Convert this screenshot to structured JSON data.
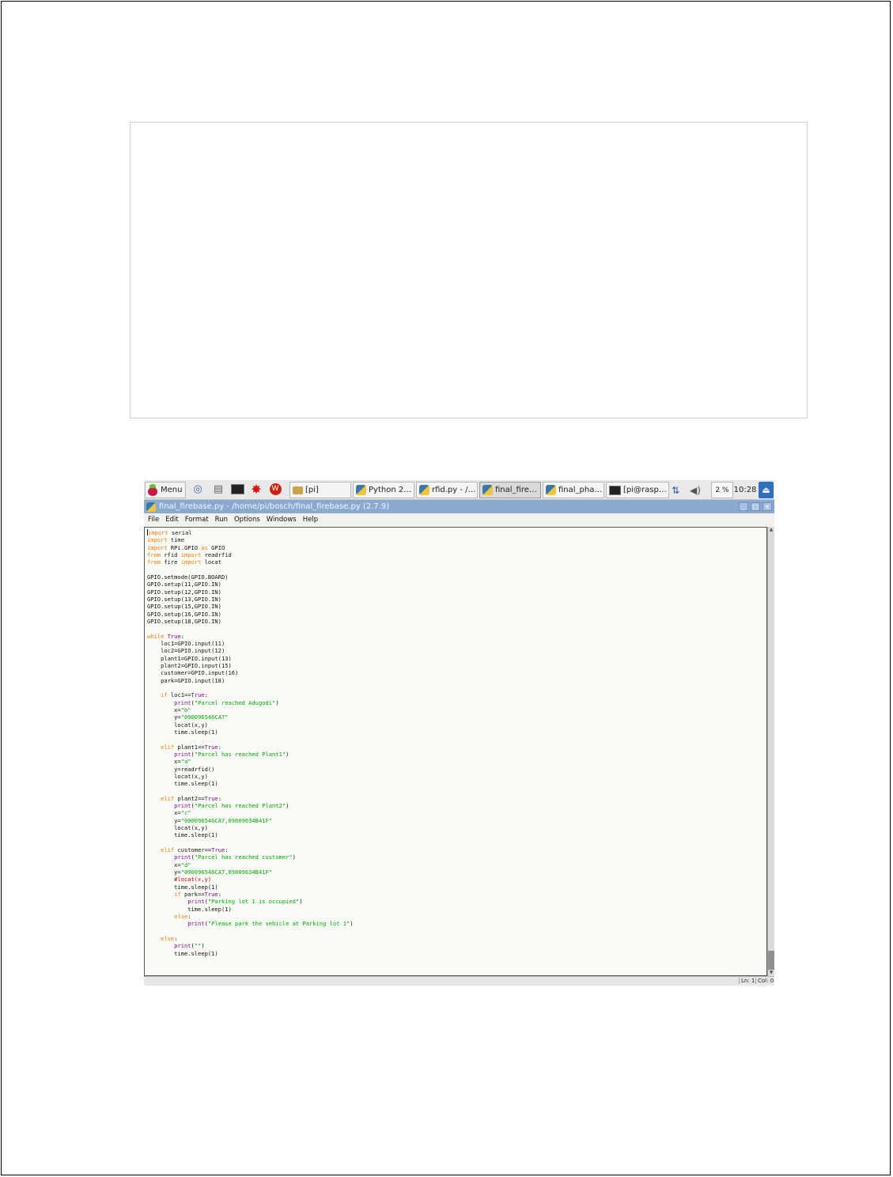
{
  "taskbar": {
    "menu_label": "Menu",
    "windows": [
      {
        "label": "[pi]",
        "icon": "folder-icon"
      },
      {
        "label": "Python 2.7....",
        "icon": "python-icon"
      },
      {
        "label": "rfid.py - /ho...",
        "icon": "python-icon"
      },
      {
        "label": "final_fireba...",
        "icon": "python-icon"
      },
      {
        "label": "final_phant...",
        "icon": "python-icon"
      },
      {
        "label": "[pi@raspbe...",
        "icon": "terminal-icon"
      }
    ],
    "cpu": "2 %",
    "clock": "10:28"
  },
  "window": {
    "title": "final_firebase.py - /home/pi/bosch/final_firebase.py (2.7.9)"
  },
  "menubar": [
    "File",
    "Edit",
    "Format",
    "Run",
    "Options",
    "Windows",
    "Help"
  ],
  "editor": {
    "lines": [
      "import serial",
      "import time",
      "import RPi.GPIO as GPIO",
      "from rfid import readrfid",
      "from fire import locat",
      "",
      "GPIO.setmode(GPIO.BOARD)",
      "GPIO.setup(11,GPIO.IN)",
      "GPIO.setup(12,GPIO.IN)",
      "GPIO.setup(13,GPIO.IN)",
      "GPIO.setup(15,GPIO.IN)",
      "GPIO.setup(16,GPIO.IN)",
      "GPIO.setup(18,GPIO.IN)",
      "",
      "while True:",
      "    loc1=GPIO.input(11)",
      "    loc2=GPIO.input(12)",
      "    plant1=GPIO.input(13)",
      "    plant2=GPIO.input(15)",
      "    customer=GPIO.input(16)",
      "    park=GPIO.input(18)",
      "",
      "    if loc1==True:",
      "        print(\"Parcel reached Adugodi\")",
      "        x=\"b\"",
      "        y=\"090096546CA7\"",
      "        locat(x,y)",
      "        time.sleep(1)",
      "",
      "    elif plant1==True:",
      "        print(\"Parcel has reached Plant1\")",
      "        x=\"a\"",
      "        y=readrfid()",
      "        locat(x,y)",
      "        time.sleep(1)",
      "",
      "    elif plant2==True:",
      "        print(\"Parcel has reached Plant2\")",
      "        x=\"c\"",
      "        y=\"090096546CA7,09009634B41F\"",
      "        locat(x,y)",
      "        time.sleep(1)",
      "",
      "    elif customer==True:",
      "        print(\"Parcel has reached customer\")",
      "        x=\"d\"",
      "        y=\"090096546CA7,09009634B41F\"",
      "        #locat(x,y)",
      "        time.sleep(1)",
      "        if park==True:",
      "            print(\"Parking lot 1 is occupied\")",
      "            time.sleep(1)",
      "        else:",
      "            print(\"Please park the vehicle at Parking lot 1\")",
      "",
      "    else:",
      "        print(\"\")",
      "        time.sleep(1)"
    ]
  },
  "status": {
    "ln": "Ln: 1",
    "col": "Col: 0"
  },
  "colors": {
    "keyword": "#ff7700",
    "builtin": "#900090",
    "string": "#00aa00",
    "comment": "#dd0000",
    "titlebar": "#8aa9cf"
  }
}
